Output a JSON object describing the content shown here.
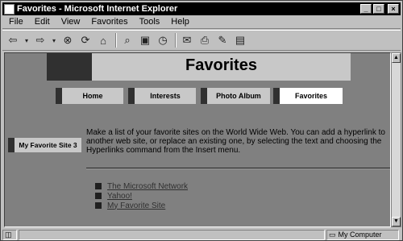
{
  "window": {
    "title": "Favorites - Microsoft Internet Explorer"
  },
  "menubar": {
    "items": [
      {
        "label": "File"
      },
      {
        "label": "Edit"
      },
      {
        "label": "View"
      },
      {
        "label": "Favorites"
      },
      {
        "label": "Tools"
      },
      {
        "label": "Help"
      }
    ]
  },
  "toolbar": {
    "icons": [
      "back-icon",
      "forward-icon",
      "stop-icon",
      "refresh-icon",
      "home-icon",
      "search-icon",
      "favorites-icon",
      "history-icon",
      "mail-icon",
      "print-icon",
      "edit-icon",
      "discuss-icon"
    ]
  },
  "page": {
    "banner_title": "Favorites",
    "nav": [
      {
        "label": "Home"
      },
      {
        "label": "Interests"
      },
      {
        "label": "Photo Album"
      },
      {
        "label": "Favorites"
      }
    ],
    "side_button": "My Favorite Site 3",
    "paragraph": "Make a list of your favorite sites on the World Wide Web. You can add a hyperlink to another web site, or replace an existing one, by selecting the text and choosing the Hyperlinks command from the Insert menu.",
    "links": [
      {
        "label": "The Microsoft Network"
      },
      {
        "label": "Yahoo!"
      },
      {
        "label": "My Favorite Site"
      }
    ]
  },
  "statusbar": {
    "zone": "My Computer"
  },
  "colors": {
    "page_bg": "#808080",
    "button_bg": "#c8c8c8",
    "active_bg": "#ffffff",
    "accent_dark": "#303030"
  }
}
